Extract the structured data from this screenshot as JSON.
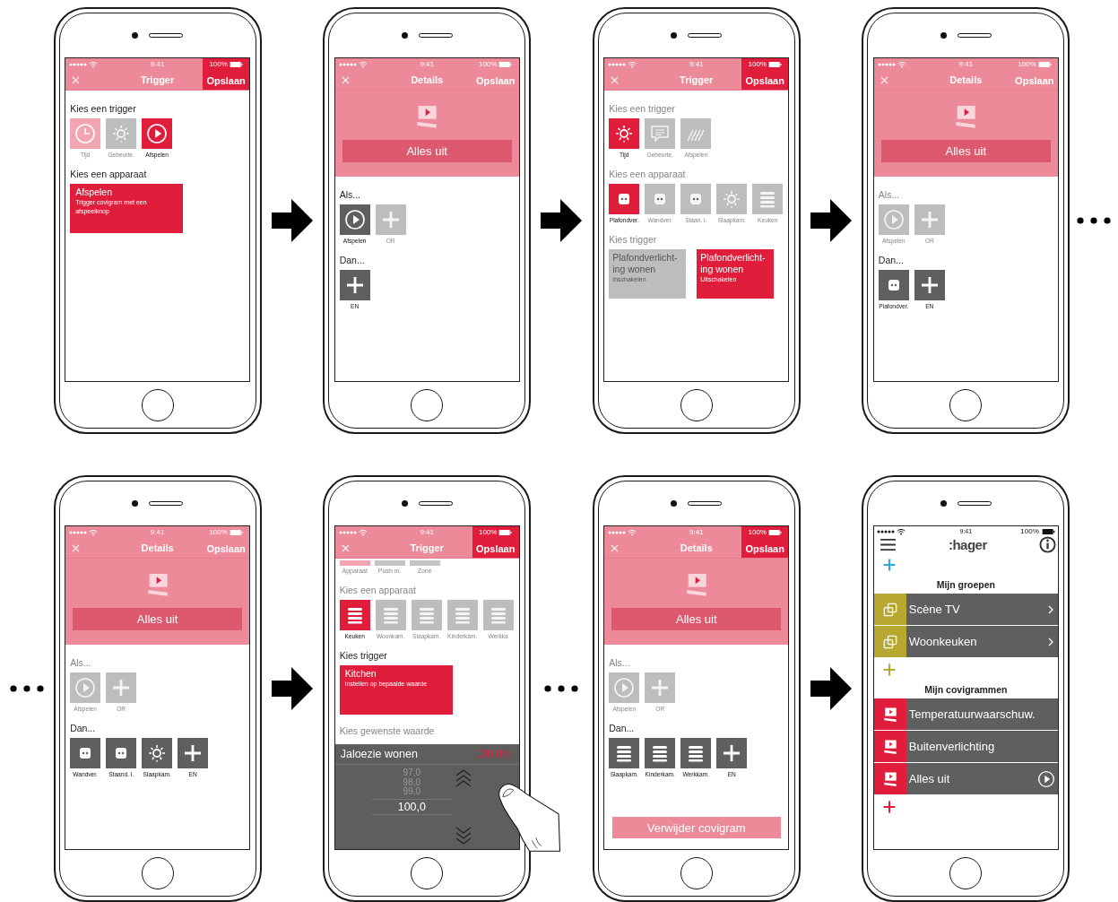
{
  "rows": [
    {
      "items": [
        {
          "kind": "space"
        },
        {
          "kind": "phone",
          "screen": {
            "kind": "editor",
            "status": {
              "time": "9:41",
              "battery": "100%"
            },
            "nav": {
              "title": "Trigger",
              "save": "Opslaan",
              "enabled": true
            },
            "sections": [
              {
                "kind": "heading",
                "text": "Kies een trigger",
                "disabled": false
              },
              {
                "kind": "tiles",
                "items": [
                  {
                    "label": "Tijd",
                    "kind": "clock",
                    "selected": false,
                    "disabled": false,
                    "pressed": true
                  },
                  {
                    "label": "Gebeurte.",
                    "kind": "lamp",
                    "selected": false,
                    "disabled": true,
                    "pressed": false
                  },
                  {
                    "label": "Afspelen",
                    "kind": "play",
                    "selected": true,
                    "disabled": false,
                    "pressed": false
                  }
                ]
              },
              {
                "kind": "heading",
                "text": "Kies een apparaat",
                "disabled": false
              },
              {
                "kind": "cards",
                "items": [
                  {
                    "title": "Afspelen",
                    "subtitle": "Trigger covigram met een afspeelknop",
                    "selected": true
                  }
                ]
              }
            ]
          }
        },
        {
          "kind": "arrow"
        },
        {
          "kind": "phone",
          "screen": {
            "kind": "editor",
            "status": {
              "time": "9:41",
              "battery": "100%"
            },
            "nav": {
              "title": "Details",
              "save": "Opslaan",
              "enabled": false
            },
            "hero": {
              "button": "Alles uit"
            },
            "sections": [
              {
                "kind": "heading",
                "text": "Als...",
                "disabled": false
              },
              {
                "kind": "tiles",
                "items": [
                  {
                    "label": "Afspelen",
                    "kind": "play",
                    "selected": false,
                    "disabled": false
                  },
                  {
                    "label": "OR",
                    "kind": "plus",
                    "selected": false,
                    "disabled": true
                  }
                ]
              },
              {
                "kind": "heading",
                "text": "Dan...",
                "disabled": false
              },
              {
                "kind": "tiles",
                "items": [
                  {
                    "label": "EN",
                    "kind": "plus",
                    "selected": false,
                    "disabled": false
                  }
                ]
              }
            ]
          }
        },
        {
          "kind": "arrow"
        },
        {
          "kind": "phone",
          "screen": {
            "kind": "editor",
            "status": {
              "time": "9:41",
              "battery": "100%"
            },
            "nav": {
              "title": "Trigger",
              "save": "Opslaan",
              "enabled": true
            },
            "sections": [
              {
                "kind": "heading",
                "text": "Kies een trigger",
                "disabled": true
              },
              {
                "kind": "tiles",
                "items": [
                  {
                    "label": "Tijd",
                    "kind": "lamp",
                    "selected": true,
                    "disabled": false
                  },
                  {
                    "label": "Gebeurte.",
                    "kind": "message",
                    "selected": false,
                    "disabled": true
                  },
                  {
                    "label": "Afspelen",
                    "kind": "wave",
                    "selected": false,
                    "disabled": true
                  }
                ]
              },
              {
                "kind": "heading",
                "text": "Kies een apparaat",
                "disabled": true
              },
              {
                "kind": "tiles",
                "items": [
                  {
                    "label": "Plafondver.",
                    "kind": "socket",
                    "selected": true,
                    "disabled": false
                  },
                  {
                    "label": "Wandver.",
                    "kind": "socket",
                    "selected": false,
                    "disabled": true
                  },
                  {
                    "label": "Staan. l.",
                    "kind": "socket",
                    "selected": false,
                    "disabled": true
                  },
                  {
                    "label": "Slaapkam.",
                    "kind": "lamp",
                    "selected": false,
                    "disabled": true
                  },
                  {
                    "label": "Keuken",
                    "kind": "blinds",
                    "selected": false,
                    "disabled": true
                  }
                ]
              },
              {
                "kind": "heading",
                "text": "Kies trigger",
                "disabled": true
              },
              {
                "kind": "cards",
                "items": [
                  {
                    "title": "Plafondverlicht-ing wonen",
                    "subtitle": "Inschakelen",
                    "selected": false
                  },
                  {
                    "title": "Plafondverlicht-ing wonen",
                    "subtitle": "Uitschakelen",
                    "selected": true
                  }
                ]
              }
            ]
          }
        },
        {
          "kind": "arrow"
        },
        {
          "kind": "phone",
          "screen": {
            "kind": "editor",
            "status": {
              "time": "9:41",
              "battery": "100%"
            },
            "nav": {
              "title": "Details",
              "save": "Opslaan",
              "enabled": false
            },
            "hero": {
              "button": "Alles uit"
            },
            "sections": [
              {
                "kind": "heading",
                "text": "Als...",
                "disabled": true
              },
              {
                "kind": "tiles",
                "items": [
                  {
                    "label": "Afspelen",
                    "kind": "play",
                    "selected": false,
                    "disabled": true
                  },
                  {
                    "label": "OR",
                    "kind": "plus",
                    "selected": false,
                    "disabled": true
                  }
                ]
              },
              {
                "kind": "heading",
                "text": "Dan...",
                "disabled": false
              },
              {
                "kind": "tiles",
                "items": [
                  {
                    "label": "Plafondver.",
                    "kind": "socket",
                    "selected": false,
                    "disabled": false
                  },
                  {
                    "label": "EN",
                    "kind": "plus",
                    "selected": false,
                    "disabled": false
                  }
                ]
              }
            ]
          }
        },
        {
          "kind": "dots"
        }
      ]
    },
    {
      "items": [
        {
          "kind": "dots"
        },
        {
          "kind": "phone",
          "screen": {
            "kind": "editor",
            "status": {
              "time": "9:41",
              "battery": "100%"
            },
            "nav": {
              "title": "Details",
              "save": "Opslaan",
              "enabled": false
            },
            "hero": {
              "button": "Alles uit"
            },
            "sections": [
              {
                "kind": "heading",
                "text": "Als...",
                "disabled": true
              },
              {
                "kind": "tiles",
                "items": [
                  {
                    "label": "Afspelen",
                    "kind": "play",
                    "selected": false,
                    "disabled": true
                  },
                  {
                    "label": "OR",
                    "kind": "plus",
                    "selected": false,
                    "disabled": true
                  }
                ]
              },
              {
                "kind": "heading",
                "text": "Dan...",
                "disabled": false
              },
              {
                "kind": "tiles",
                "items": [
                  {
                    "label": "Wandver.",
                    "kind": "socket",
                    "selected": false,
                    "disabled": false
                  },
                  {
                    "label": "Staand. l.",
                    "kind": "socket",
                    "selected": false,
                    "disabled": false
                  },
                  {
                    "label": "Slaapkam.",
                    "kind": "lamp",
                    "selected": false,
                    "disabled": false
                  },
                  {
                    "label": "EN",
                    "kind": "plus",
                    "selected": false,
                    "disabled": false
                  }
                ]
              }
            ]
          }
        },
        {
          "kind": "arrow"
        },
        {
          "kind": "phone",
          "screen": {
            "kind": "editor",
            "status": {
              "time": "9:41",
              "battery": "100%"
            },
            "nav": {
              "title": "Trigger",
              "save": "Opslaan",
              "enabled": true
            },
            "touch": true,
            "sections": [
              {
                "kind": "tabs",
                "items": [
                  {
                    "label": "Apparaat",
                    "selected": true
                  },
                  {
                    "label": "Push m.",
                    "selected": false
                  },
                  {
                    "label": "Zone",
                    "selected": false
                  }
                ]
              },
              {
                "kind": "heading",
                "text": "Kies een apparaat",
                "disabled": true
              },
              {
                "kind": "tiles",
                "items": [
                  {
                    "label": "Keuken",
                    "kind": "blinds",
                    "selected": true,
                    "disabled": false
                  },
                  {
                    "label": "Woonkam.",
                    "kind": "blinds",
                    "selected": false,
                    "disabled": true
                  },
                  {
                    "label": "Slaapkam.",
                    "kind": "blinds",
                    "selected": false,
                    "disabled": true
                  },
                  {
                    "label": "Kinderkam.",
                    "kind": "blinds",
                    "selected": false,
                    "disabled": true
                  },
                  {
                    "label": "Werkka",
                    "kind": "blinds",
                    "selected": false,
                    "disabled": true
                  }
                ]
              },
              {
                "kind": "heading",
                "text": "Kies trigger",
                "disabled": false
              },
              {
                "kind": "cards",
                "items": [
                  {
                    "title": "Kitchen",
                    "subtitle": "Instellen op bepaalde waarde",
                    "selected": true
                  }
                ]
              },
              {
                "kind": "heading",
                "text": "Kies gewenste waarde",
                "disabled": true
              },
              {
                "kind": "picker",
                "title": "Jaloezie wonen",
                "reading": "100,0%",
                "values": [
                  "97,0",
                  "98,0",
                  "99,0"
                ],
                "current": "100,0"
              }
            ]
          }
        },
        {
          "kind": "dots"
        },
        {
          "kind": "phone",
          "screen": {
            "kind": "editor",
            "status": {
              "time": "9:41",
              "battery": "100%"
            },
            "nav": {
              "title": "Details",
              "save": "Opslaan",
              "enabled": true
            },
            "hero": {
              "button": "Alles uit"
            },
            "sections": [
              {
                "kind": "heading",
                "text": "Als...",
                "disabled": true
              },
              {
                "kind": "tiles",
                "items": [
                  {
                    "label": "Afspelen",
                    "kind": "play",
                    "selected": false,
                    "disabled": true
                  },
                  {
                    "label": "OR",
                    "kind": "plus",
                    "selected": false,
                    "disabled": true
                  }
                ]
              },
              {
                "kind": "heading",
                "text": "Dan...",
                "disabled": false
              },
              {
                "kind": "tiles",
                "items": [
                  {
                    "label": "Slaapkam.",
                    "kind": "blinds",
                    "selected": false,
                    "disabled": false
                  },
                  {
                    "label": "Kinderkam.",
                    "kind": "blinds",
                    "selected": false,
                    "disabled": false
                  },
                  {
                    "label": "Werkkam.",
                    "kind": "blinds",
                    "selected": false,
                    "disabled": false
                  },
                  {
                    "label": "EN",
                    "kind": "plus",
                    "selected": false,
                    "disabled": false
                  }
                ]
              },
              {
                "kind": "button",
                "label": "Verwijder covigram",
                "disabled": true
              }
            ]
          }
        },
        {
          "kind": "arrow"
        },
        {
          "kind": "phone",
          "screen": {
            "kind": "home",
            "status": {
              "time": "9:41",
              "battery": "100%"
            },
            "logo": ":hager",
            "sections": [
              {
                "kind": "add",
                "color": "#27a9e1"
              },
              {
                "kind": "title",
                "text": "Mijn groepen"
              },
              {
                "kind": "rows",
                "items": [
                  {
                    "label": "Scène TV",
                    "kind": "group",
                    "play": false
                  },
                  {
                    "label": "Woonkeuken",
                    "kind": "group",
                    "play": false
                  }
                ]
              },
              {
                "kind": "add",
                "color": "#b8a832"
              },
              {
                "kind": "title",
                "text": "Mijn covigrammen"
              },
              {
                "kind": "rows",
                "items": [
                  {
                    "label": "Temperatuurwaarschuw.",
                    "kind": "covigram",
                    "play": false
                  },
                  {
                    "label": "Buitenverlichting",
                    "kind": "covigram",
                    "play": false
                  },
                  {
                    "label": "Alles uit",
                    "kind": "covigram",
                    "play": true
                  }
                ]
              },
              {
                "kind": "add",
                "color": "#e01e3c"
              }
            ]
          }
        },
        {
          "kind": "space"
        }
      ]
    }
  ]
}
